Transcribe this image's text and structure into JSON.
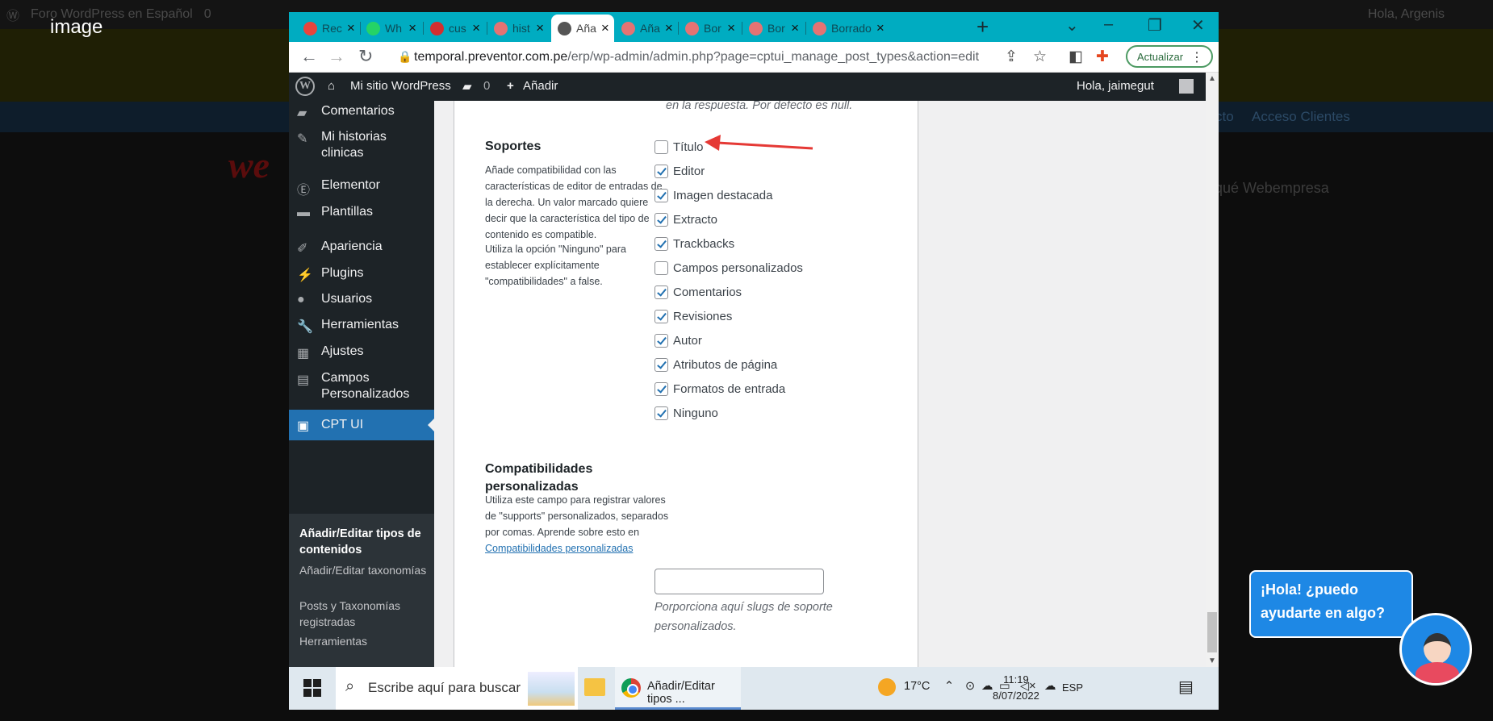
{
  "lightbox": {
    "caption": "image"
  },
  "background": {
    "adminbar": {
      "site": "Foro WordPress en Español",
      "comments": "0",
      "greeting": "Hola, Argenis"
    },
    "nav": {
      "item1": "cto",
      "item2": "Acceso Clientes"
    },
    "logo": "we",
    "why": "qué Webempresa"
  },
  "browser": {
    "tabs": [
      {
        "label": "Rec",
        "color": "#e8453c"
      },
      {
        "label": "Wh",
        "color": "#25d366"
      },
      {
        "label": "cus",
        "color": "#d32f2f"
      },
      {
        "label": "hist",
        "color": "#e57373"
      },
      {
        "label": "Aña",
        "color": "#555555"
      },
      {
        "label": "Aña",
        "color": "#e57373"
      },
      {
        "label": "Bor",
        "color": "#e57373"
      },
      {
        "label": "Bor",
        "color": "#e57373"
      },
      {
        "label": "Borrado",
        "color": "#e57373"
      }
    ],
    "active_tab_index": 4,
    "url_domain": "temporal.preventor.com.pe",
    "url_path": "/erp/wp-admin/admin.php?page=cptui_manage_post_types&action=edit",
    "update_label": "Actualizar"
  },
  "wp_adminbar": {
    "site": "Mi sitio WordPress",
    "comments": "0",
    "add": "Añadir",
    "greeting": "Hola, jaimegut"
  },
  "sidebar": {
    "items": [
      {
        "label": "Comentarios",
        "icon": "comment-icon"
      },
      {
        "label": "Mi historias clinicas",
        "icon": "pin-icon"
      },
      {
        "label": "Elementor",
        "icon": "elementor-icon"
      },
      {
        "label": "Plantillas",
        "icon": "folder-icon"
      },
      {
        "label": "Apariencia",
        "icon": "brush-icon"
      },
      {
        "label": "Plugins",
        "icon": "plugin-icon"
      },
      {
        "label": "Usuarios",
        "icon": "user-icon"
      },
      {
        "label": "Herramientas",
        "icon": "wrench-icon"
      },
      {
        "label": "Ajustes",
        "icon": "settings-icon"
      },
      {
        "label": "Campos Personalizados",
        "icon": "fields-icon"
      },
      {
        "label": "CPT UI",
        "icon": "cptui-icon"
      }
    ],
    "submenu": [
      "Añadir/Editar tipos de contenidos",
      "Añadir/Editar taxonomías",
      "Posts y Taxonomías registradas",
      "Herramientas"
    ]
  },
  "content": {
    "prev_text": "en la respuesta. Por defecto es null.",
    "supports": {
      "title": "Soportes",
      "desc1": "Añade compatibilidad con las características de editor de entradas de la derecha. Un valor marcado quiere decir que la característica del tipo de contenido es compatible.",
      "desc2": "Utiliza la opción \"Ninguno\" para establecer explícitamente \"compatibilidades\" a false.",
      "options": [
        {
          "label": "Título",
          "checked": false
        },
        {
          "label": "Editor",
          "checked": true
        },
        {
          "label": "Imagen destacada",
          "checked": true
        },
        {
          "label": "Extracto",
          "checked": true
        },
        {
          "label": "Trackbacks",
          "checked": true
        },
        {
          "label": "Campos personalizados",
          "checked": false
        },
        {
          "label": "Comentarios",
          "checked": true
        },
        {
          "label": "Revisiones",
          "checked": true
        },
        {
          "label": "Autor",
          "checked": true
        },
        {
          "label": "Atributos de página",
          "checked": true
        },
        {
          "label": "Formatos de entrada",
          "checked": true
        },
        {
          "label": "Ninguno",
          "checked": true
        }
      ]
    },
    "custom_supports": {
      "title": "Compatibilidades personalizadas",
      "desc": "Utiliza este campo para registrar valores de \"supports\" personalizados, separados por comas. Aprende sobre esto en",
      "link": "Compatibilidades personalizadas",
      "input_value": "",
      "hint": "Porporciona aquí slugs de soporte personalizados."
    },
    "annotation_color": "#e53935"
  },
  "taskbar": {
    "search_placeholder": "Escribe aquí para buscar",
    "chrome_label": "Añadir/Editar tipos ...",
    "temperature": "17°C",
    "lang": "ESP",
    "time": "11:19",
    "date": "8/07/2022"
  },
  "chat": {
    "line1": "¡Hola! ¿puedo",
    "line2": "ayudarte en algo?"
  }
}
